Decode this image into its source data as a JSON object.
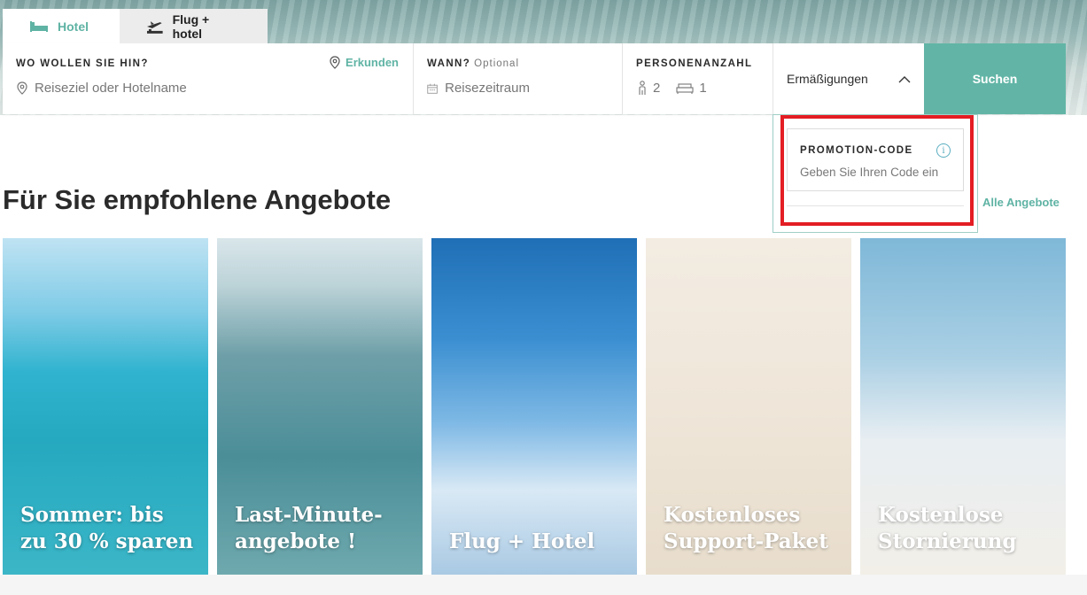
{
  "tabs": [
    {
      "label": "Hotel",
      "icon": "bed-icon",
      "active": true
    },
    {
      "label": "Flug + hotel",
      "icon": "plane-icon",
      "active": false
    }
  ],
  "search": {
    "destination_label": "WO WOLLEN SIE HIN?",
    "explore_label": "Erkunden",
    "destination_placeholder": "Reiseziel oder Hotelname",
    "when_label": "WANN?",
    "when_optional": "Optional",
    "when_placeholder": "Reisezeitraum",
    "persons_label": "PERSONENANZAHL",
    "adults": "2",
    "rooms": "1",
    "discounts_label": "Ermäßigungen",
    "submit_label": "Suchen"
  },
  "promo": {
    "title": "PROMOTION-CODE",
    "placeholder": "Geben Sie Ihren Code ein",
    "info": "i"
  },
  "offers": {
    "title": "Für Sie empfohlene Angebote",
    "all_link": "Alle Angebote",
    "cards": [
      {
        "line1": "Sommer: bis",
        "line2": "zu 30 % sparen"
      },
      {
        "line1": "Last-Minute-",
        "line2": "angebote !"
      },
      {
        "line1": "",
        "line2": "Flug + Hotel"
      },
      {
        "line1": "Kostenloses",
        "line2": "Support-Paket"
      },
      {
        "line1": "Kostenlose",
        "line2": "Stornierung"
      }
    ]
  },
  "colors": {
    "accent": "#62b5a6",
    "highlight": "#e31e24"
  }
}
